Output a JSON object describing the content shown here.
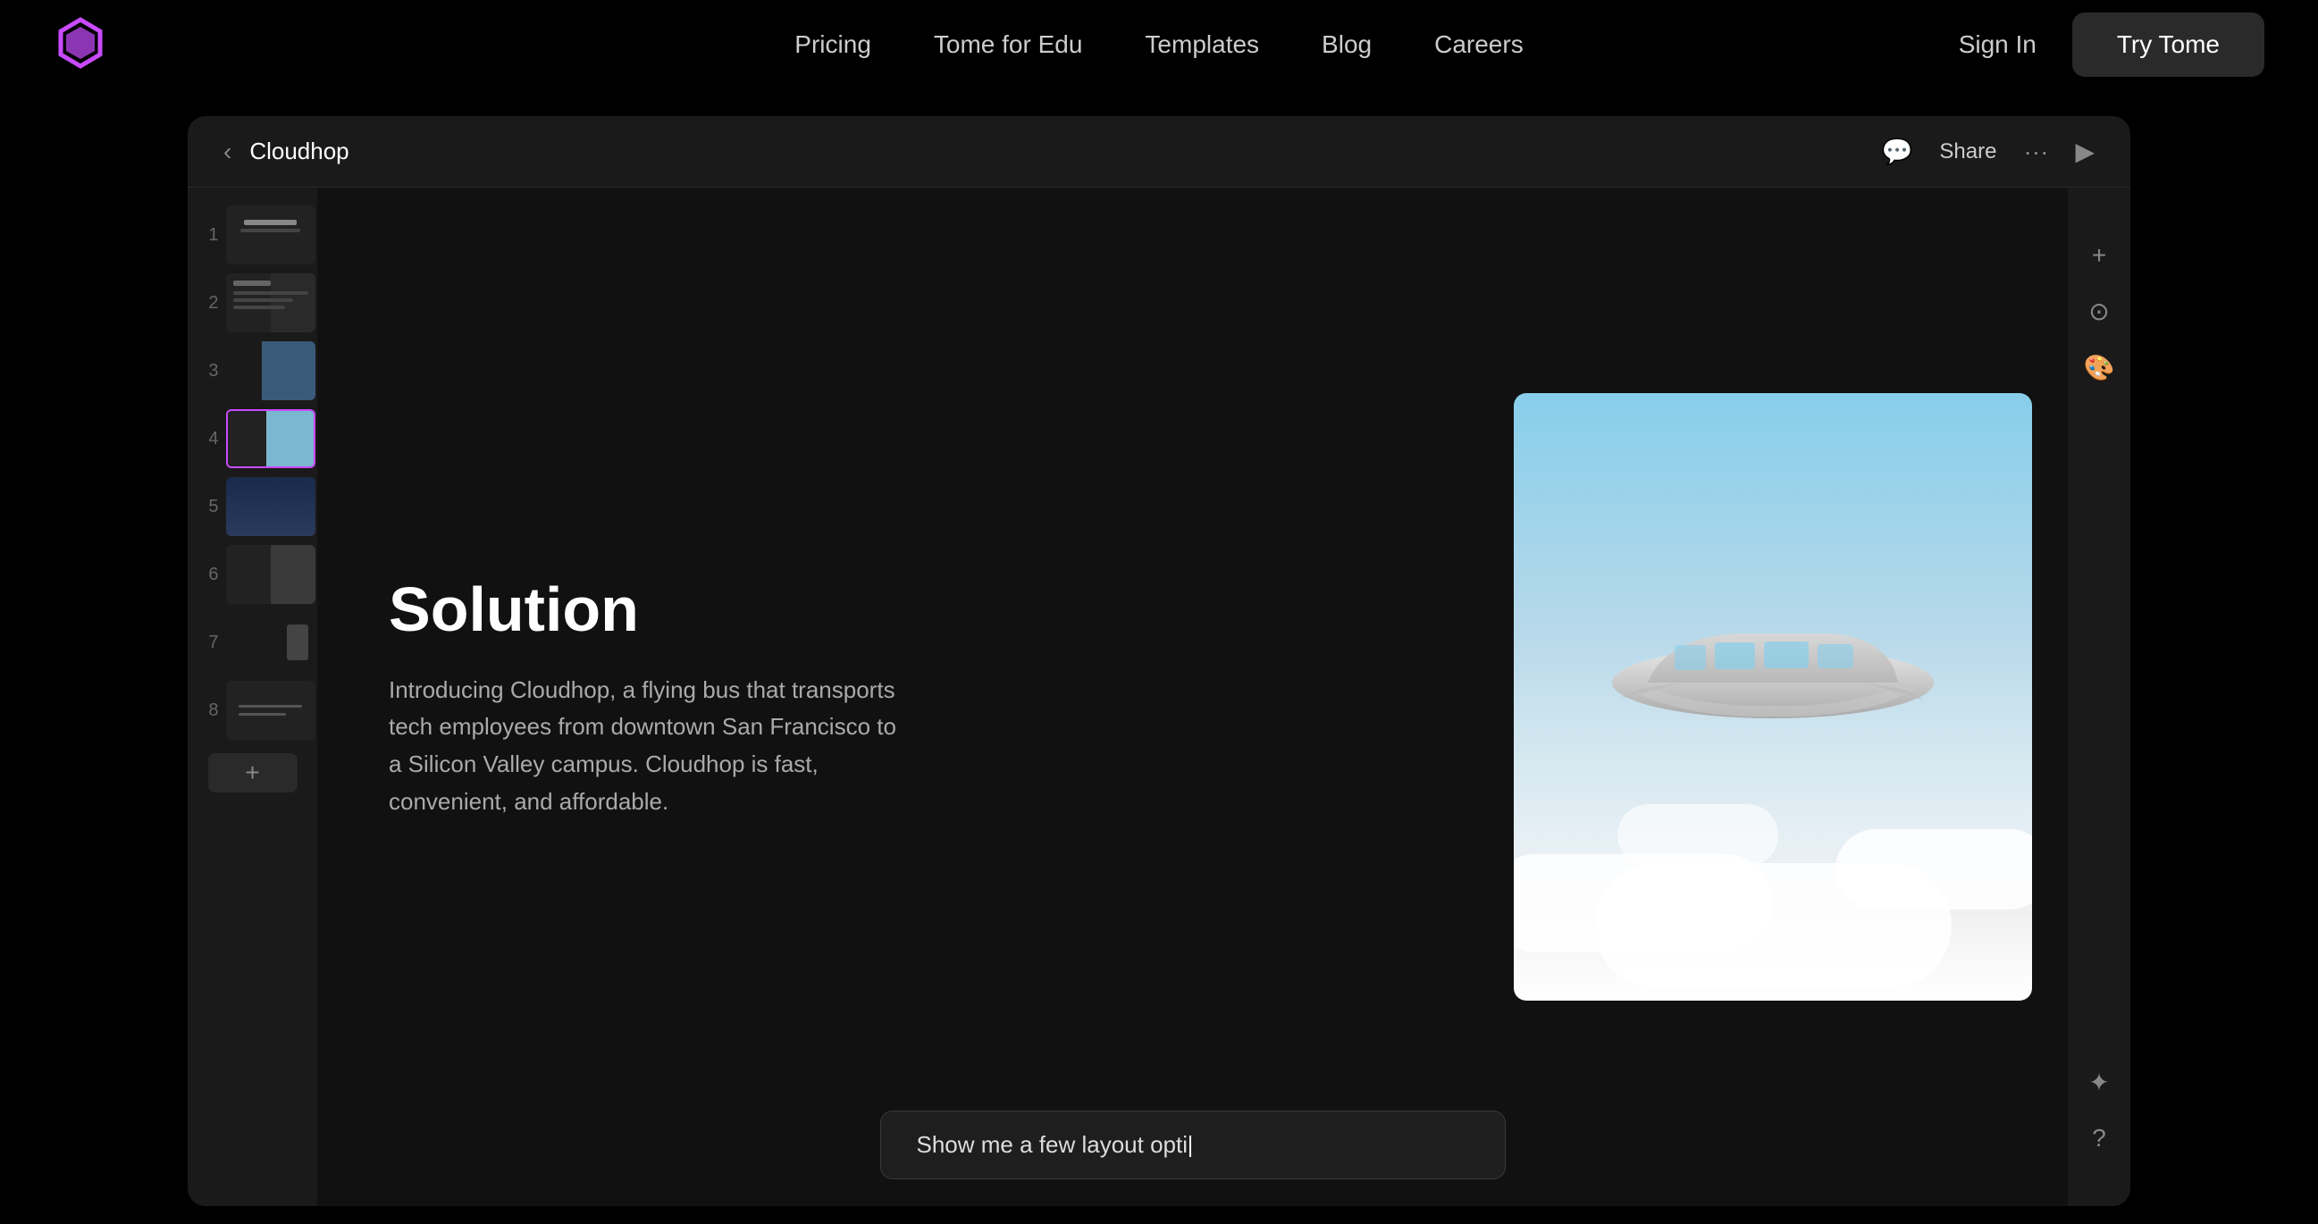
{
  "navbar": {
    "logo_alt": "Tome logo",
    "links": [
      {
        "label": "Pricing",
        "id": "pricing"
      },
      {
        "label": "Tome for Edu",
        "id": "tome-edu"
      },
      {
        "label": "Templates",
        "id": "templates"
      },
      {
        "label": "Blog",
        "id": "blog"
      },
      {
        "label": "Careers",
        "id": "careers"
      }
    ],
    "sign_in_label": "Sign In",
    "try_tome_label": "Try Tome"
  },
  "app": {
    "toolbar": {
      "back_label": "‹",
      "title": "Cloudhop",
      "comment_icon": "💬",
      "share_label": "Share",
      "more_icon": "···",
      "play_icon": "▶"
    },
    "sidebar": {
      "slides": [
        {
          "num": "1",
          "active": false
        },
        {
          "num": "2",
          "active": false
        },
        {
          "num": "3",
          "active": false
        },
        {
          "num": "4",
          "active": true
        },
        {
          "num": "5",
          "active": false
        },
        {
          "num": "6",
          "active": false
        },
        {
          "num": "7",
          "active": false
        },
        {
          "num": "8",
          "active": false
        }
      ],
      "add_label": "+"
    },
    "slide": {
      "heading": "Solution",
      "body": "Introducing Cloudhop, a flying bus that transports tech employees from downtown San Francisco to a Silicon Valley campus. Cloudhop is fast, convenient, and affordable."
    },
    "prompt": {
      "text": "Show me a few layout opti",
      "placeholder": "Show me a few layout opti"
    },
    "right_tools": {
      "add_icon": "+",
      "target_icon": "⊙",
      "palette_icon": "🎨",
      "sparkle_icon": "✦",
      "help_icon": "?"
    }
  }
}
